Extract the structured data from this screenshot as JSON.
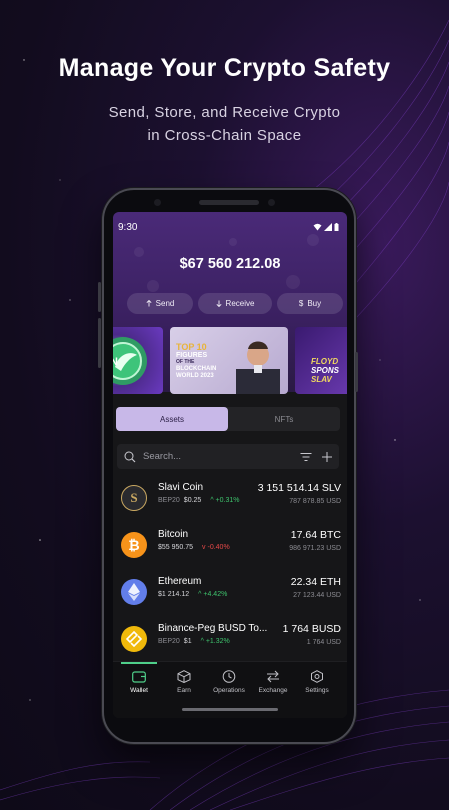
{
  "promo": {
    "headline": "Manage Your Crypto Safety",
    "subline_1": "Send, Store, and Receive Crypto",
    "subline_2": "in Cross-Chain Space"
  },
  "status_bar": {
    "time": "9:30"
  },
  "wallet": {
    "balance": "$67 560 212.08",
    "actions": {
      "send": "Send",
      "receive": "Receive",
      "buy": "Buy"
    }
  },
  "banners": {
    "b2_line1": "TOP 10",
    "b2_line2": "FIGURES",
    "b2_line3": "OF THE",
    "b2_line4": "BLOCKCHAIN",
    "b2_line5": "WORLD 2023",
    "b3_line1": "FLOYD",
    "b3_line2": "SPONS",
    "b3_line3": "SLAV"
  },
  "tabs": {
    "assets": "Assets",
    "nfts": "NFTs"
  },
  "search": {
    "placeholder": "Search..."
  },
  "assets": [
    {
      "name": "Slavi Coin",
      "network": "BEP20",
      "price": "$0.25",
      "change": "^ +0.31%",
      "amount": "3 151 514.14 SLV",
      "usd": "787 878.85 USD",
      "icon": "slavi-coin-icon",
      "color": "#2a2a2e"
    },
    {
      "name": "Bitcoin",
      "network": "",
      "price": "$55 950.75",
      "change": "v -0.40%",
      "amount": "17.64 BTC",
      "usd": "986 971.23 USD",
      "icon": "bitcoin-icon",
      "color": "#f7931a"
    },
    {
      "name": "Ethereum",
      "network": "",
      "price": "$1 214.12",
      "change": "^ +4.42%",
      "amount": "22.34 ETH",
      "usd": "27 123.44 USD",
      "icon": "ethereum-icon",
      "color": "#627eea"
    },
    {
      "name": "Binance-Peg BUSD To...",
      "network": "BEP20",
      "price": "$1",
      "change": "^ +1.32%",
      "amount": "1 764 BUSD",
      "usd": "1 764 USD",
      "icon": "busd-icon",
      "color": "#f0b90b"
    }
  ],
  "nav": {
    "wallet": "Wallet",
    "earn": "Earn",
    "operations": "Operations",
    "exchange": "Exchange",
    "settings": "Settings"
  },
  "colors": {
    "accent_green": "#4fcf8a",
    "positive": "#3ec46d",
    "negative": "#e54848",
    "header_purple": "#4a2a78"
  }
}
